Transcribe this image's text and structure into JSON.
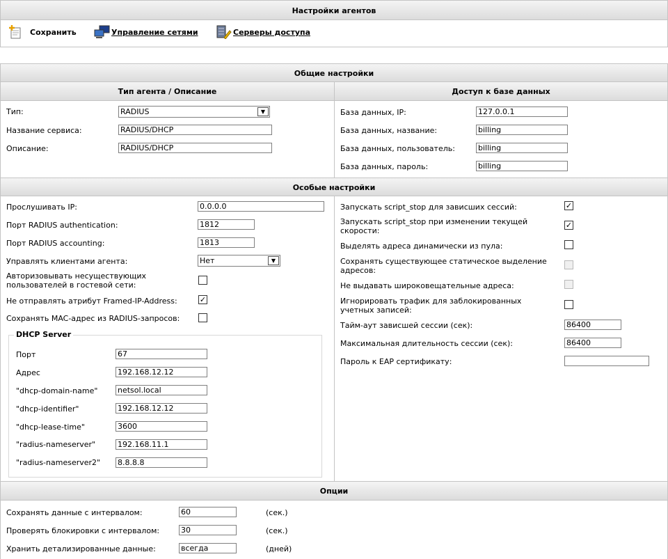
{
  "title": "Настройки агентов",
  "toolbar": {
    "save": "Сохранить",
    "networks": "Управление сетями",
    "servers": "Серверы доступа"
  },
  "general": {
    "title": "Общие настройки",
    "left_title": "Тип агента / Описание",
    "right_title": "Доступ к базе данных",
    "type_label": "Тип:",
    "type_value": "RADIUS",
    "service_label": "Название сервиса:",
    "service_value": "RADIUS/DHCP",
    "desc_label": "Описание:",
    "desc_value": "RADIUS/DHCP",
    "db_ip_label": "База данных, IP:",
    "db_ip_value": "127.0.0.1",
    "db_name_label": "База данных, название:",
    "db_name_value": "billing",
    "db_user_label": "База данных, пользователь:",
    "db_user_value": "billing",
    "db_pass_label": "База данных, пароль:",
    "db_pass_value": "billing"
  },
  "special": {
    "title": "Особые настройки",
    "listen_ip_label": "Прослушивать IP:",
    "listen_ip_value": "0.0.0.0",
    "auth_port_label": "Порт RADIUS authentication:",
    "auth_port_value": "1812",
    "acct_port_label": "Порт RADIUS accounting:",
    "acct_port_value": "1813",
    "manage_label": "Управлять клиентами агента:",
    "manage_value": "Нет",
    "guest_label": "Авторизовывать несуществующих пользователей в гостевой сети:",
    "guest_checked": false,
    "framed_label": "Не отправлять атрибут Framed-IP-Address:",
    "framed_checked": true,
    "mac_label": "Сохранять MAC-адрес из RADIUS-запросов:",
    "mac_checked": false,
    "dhcp": {
      "title": "DHCP Server",
      "port_label": "Порт",
      "port_value": "67",
      "addr_label": "Адрес",
      "addr_value": "192.168.12.12",
      "domain_label": "\"dhcp-domain-name\"",
      "domain_value": "netsol.local",
      "ident_label": "\"dhcp-identifier\"",
      "ident_value": "192.168.12.12",
      "lease_label": "\"dhcp-lease-time\"",
      "lease_value": "3600",
      "ns_label": "\"radius-nameserver\"",
      "ns_value": "192.168.11.1",
      "ns2_label": "\"radius-nameserver2\"",
      "ns2_value": "8.8.8.8"
    },
    "stop_hung_label": "Запускать script_stop для зависших сессий:",
    "stop_hung_checked": true,
    "stop_speed_label": "Запускать script_stop при изменении текущей скорости:",
    "stop_speed_checked": true,
    "dynamic_label": "Выделять адреса динамически из пула:",
    "dynamic_checked": false,
    "keep_static_label": "Сохранять существующее статическое выделение адресов:",
    "keep_static_checked": false,
    "no_broadcast_label": "Не выдавать широковещательные адреса:",
    "no_broadcast_checked": false,
    "ignore_blocked_label": "Игнорировать трафик для заблокированных учетных записей:",
    "ignore_blocked_checked": false,
    "hung_timeout_label": "Тайм-аут зависшей сессии (сек):",
    "hung_timeout_value": "86400",
    "max_session_label": "Максимальная длительность сессии (сек):",
    "max_session_value": "86400",
    "eap_label": "Пароль к EAP сертификату:",
    "eap_value": ""
  },
  "options": {
    "title": "Опции",
    "save_interval_label": "Сохранять данные с интервалом:",
    "save_interval_value": "60",
    "save_interval_unit": "(сек.)",
    "block_interval_label": "Проверять блокировки с интервалом:",
    "block_interval_value": "30",
    "block_interval_unit": "(сек.)",
    "keep_detail_label": "Хранить детализированные данные:",
    "keep_detail_value": "всегда",
    "keep_detail_unit": "(дней)"
  }
}
